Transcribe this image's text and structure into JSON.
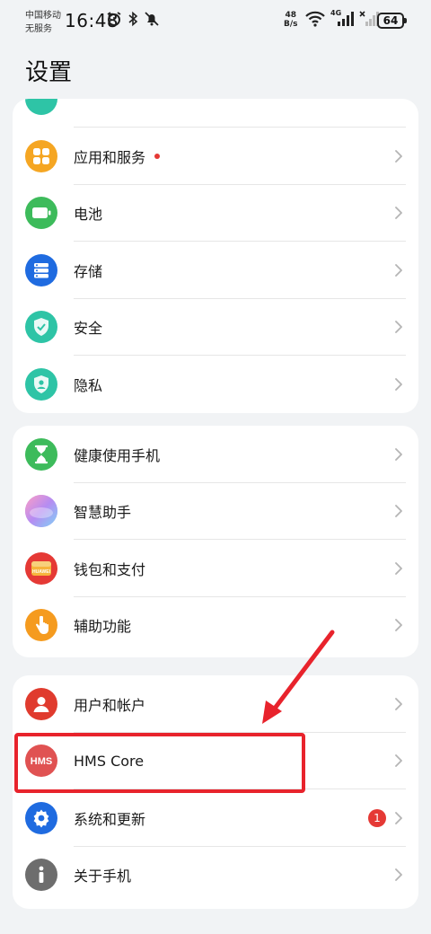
{
  "status_bar": {
    "carrier_line1": "中国移动",
    "carrier_line2": "无服务",
    "time": "16:48",
    "net_speed_value": "48",
    "net_speed_unit": "B/s",
    "network_type": "4G",
    "battery": "64"
  },
  "page_title": "设置",
  "cards": [
    {
      "items": [
        {
          "label": "应用和服务",
          "icon": "apps-grid-icon",
          "color": "#f5a623",
          "dot": true
        },
        {
          "label": "电池",
          "icon": "battery-icon",
          "color": "#3dbb5b"
        },
        {
          "label": "存储",
          "icon": "storage-icon",
          "color": "#1f6be0"
        },
        {
          "label": "安全",
          "icon": "shield-icon",
          "color": "#2ec4a6"
        },
        {
          "label": "隐私",
          "icon": "privacy-icon",
          "color": "#2ec4a6"
        }
      ]
    },
    {
      "items": [
        {
          "label": "健康使用手机",
          "icon": "hourglass-icon",
          "color": "#3dbb5b"
        },
        {
          "label": "智慧助手",
          "icon": "assistant-icon",
          "color": "#b58cf2"
        },
        {
          "label": "钱包和支付",
          "icon": "wallet-icon",
          "color": "#e53935",
          "icon_text": "HUAWEI"
        },
        {
          "label": "辅助功能",
          "icon": "accessibility-hand-icon",
          "color": "#f59b1f"
        }
      ]
    },
    {
      "items": [
        {
          "label": "用户和帐户",
          "icon": "user-icon",
          "color": "#e03b2e"
        },
        {
          "label": "HMS Core",
          "icon": "hms-icon",
          "color": "#e05252",
          "icon_text": "HMS"
        },
        {
          "label": "系统和更新",
          "icon": "gear-icon",
          "color": "#1f6be0",
          "badge": "1"
        },
        {
          "label": "关于手机",
          "icon": "info-icon",
          "color": "#6d6d6d"
        }
      ]
    }
  ],
  "colors": {
    "background": "#f1f3f5",
    "highlight": "#e8232c",
    "notification_dot": "#e53935"
  }
}
